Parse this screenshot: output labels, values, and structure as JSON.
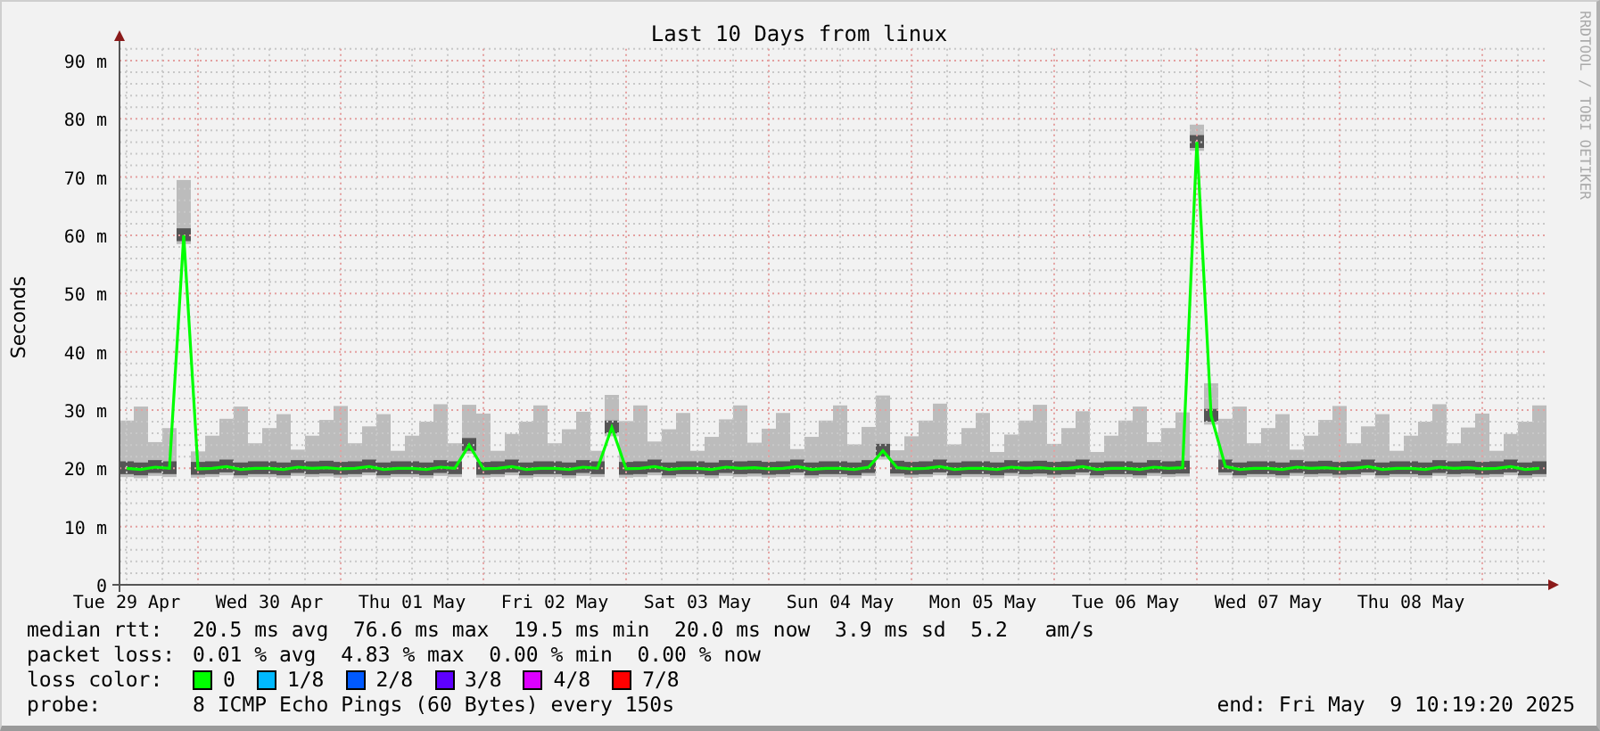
{
  "chart": {
    "credit": "RRDTOOL / TOBI OETIKER",
    "chart_data": {
      "type": "line",
      "title": "Last 10 Days from linux",
      "ylabel": "Seconds",
      "grid": true,
      "ylim": [
        0,
        92
      ],
      "categories": [
        "Tue 29 Apr",
        null,
        null,
        null,
        null,
        null,
        null,
        null,
        null,
        null,
        "Wed 30 Apr",
        null,
        null,
        null,
        null,
        null,
        null,
        null,
        null,
        null,
        "Thu 01 May",
        null,
        null,
        null,
        null,
        null,
        null,
        null,
        null,
        null,
        "Fri 02 May",
        null,
        null,
        null,
        null,
        null,
        null,
        null,
        null,
        null,
        "Sat 03 May",
        null,
        null,
        null,
        null,
        null,
        null,
        null,
        null,
        null,
        "Sun 04 May",
        null,
        null,
        null,
        null,
        null,
        null,
        null,
        null,
        null,
        "Mon 05 May",
        null,
        null,
        null,
        null,
        null,
        null,
        null,
        null,
        null,
        "Tue 06 May",
        null,
        null,
        null,
        null,
        null,
        null,
        null,
        null,
        null,
        "Wed 07 May",
        null,
        null,
        null,
        null,
        null,
        null,
        null,
        null,
        null,
        "Thu 08 May",
        null,
        null,
        null,
        null,
        null,
        null,
        null,
        null,
        null
      ],
      "yticks": [
        {
          "value": 0,
          "label": "0"
        },
        {
          "value": 10,
          "label": "10 m"
        },
        {
          "value": 20,
          "label": "20 m"
        },
        {
          "value": 30,
          "label": "30 m"
        },
        {
          "value": 40,
          "label": "40 m"
        },
        {
          "value": 50,
          "label": "50 m"
        },
        {
          "value": 60,
          "label": "60 m"
        },
        {
          "value": 70,
          "label": "70 m"
        },
        {
          "value": 80,
          "label": "80 m"
        },
        {
          "value": 90,
          "label": "90 m"
        }
      ],
      "series": [
        {
          "color": "#00ff00",
          "values": [
            20,
            19.8,
            20.2,
            20,
            60,
            19.9,
            20,
            20.3,
            19.8,
            20,
            20,
            19.8,
            20.2,
            20,
            20.1,
            19.9,
            20,
            20.3,
            19.8,
            20,
            20,
            19.8,
            20.2,
            20,
            24,
            19.9,
            20,
            20.3,
            19.8,
            20,
            20,
            19.8,
            20.2,
            20,
            27,
            19.9,
            20,
            20.3,
            19.8,
            20,
            20,
            19.8,
            20.2,
            20,
            20.1,
            19.9,
            20,
            20.3,
            19.8,
            20,
            20,
            19.8,
            20.2,
            23,
            20.1,
            19.9,
            20,
            20.3,
            19.8,
            20,
            20,
            19.8,
            20.2,
            20,
            20.1,
            19.9,
            20,
            20.3,
            19.8,
            20,
            20,
            19.8,
            20.2,
            20,
            20.1,
            76,
            29,
            20.3,
            19.8,
            20,
            20,
            19.8,
            20.2,
            20,
            20.1,
            19.9,
            20,
            20.3,
            19.8,
            20,
            20,
            19.8,
            20.2,
            20,
            20.1,
            19.9,
            20,
            20.3,
            19.8,
            20
          ]
        }
      ]
    }
  },
  "stats": [
    {
      "label": "median rtt:",
      "value": "20.5 ms avg  76.6 ms max  19.5 ms min  20.0 ms now  3.9 ms sd  5.2   am/s"
    },
    {
      "label": "packet loss:",
      "value": "0.01 % avg  4.83 % max  0.00 % min  0.00 % now"
    }
  ],
  "loss_legend": {
    "label": "loss color:",
    "items": [
      {
        "label": "0",
        "color": "#00ff00"
      },
      {
        "label": "1/8",
        "color": "#00b8ff"
      },
      {
        "label": "2/8",
        "color": "#0059ff"
      },
      {
        "label": "3/8",
        "color": "#5e00ff"
      },
      {
        "label": "4/8",
        "color": "#dd00ff"
      },
      {
        "label": "7/8",
        "color": "#ff0000"
      }
    ]
  },
  "probe": {
    "label": "probe:",
    "value": "8 ICMP Echo Pings (60 Bytes) every 150s"
  },
  "end": "end: Fri May  9 10:19:20 2025"
}
